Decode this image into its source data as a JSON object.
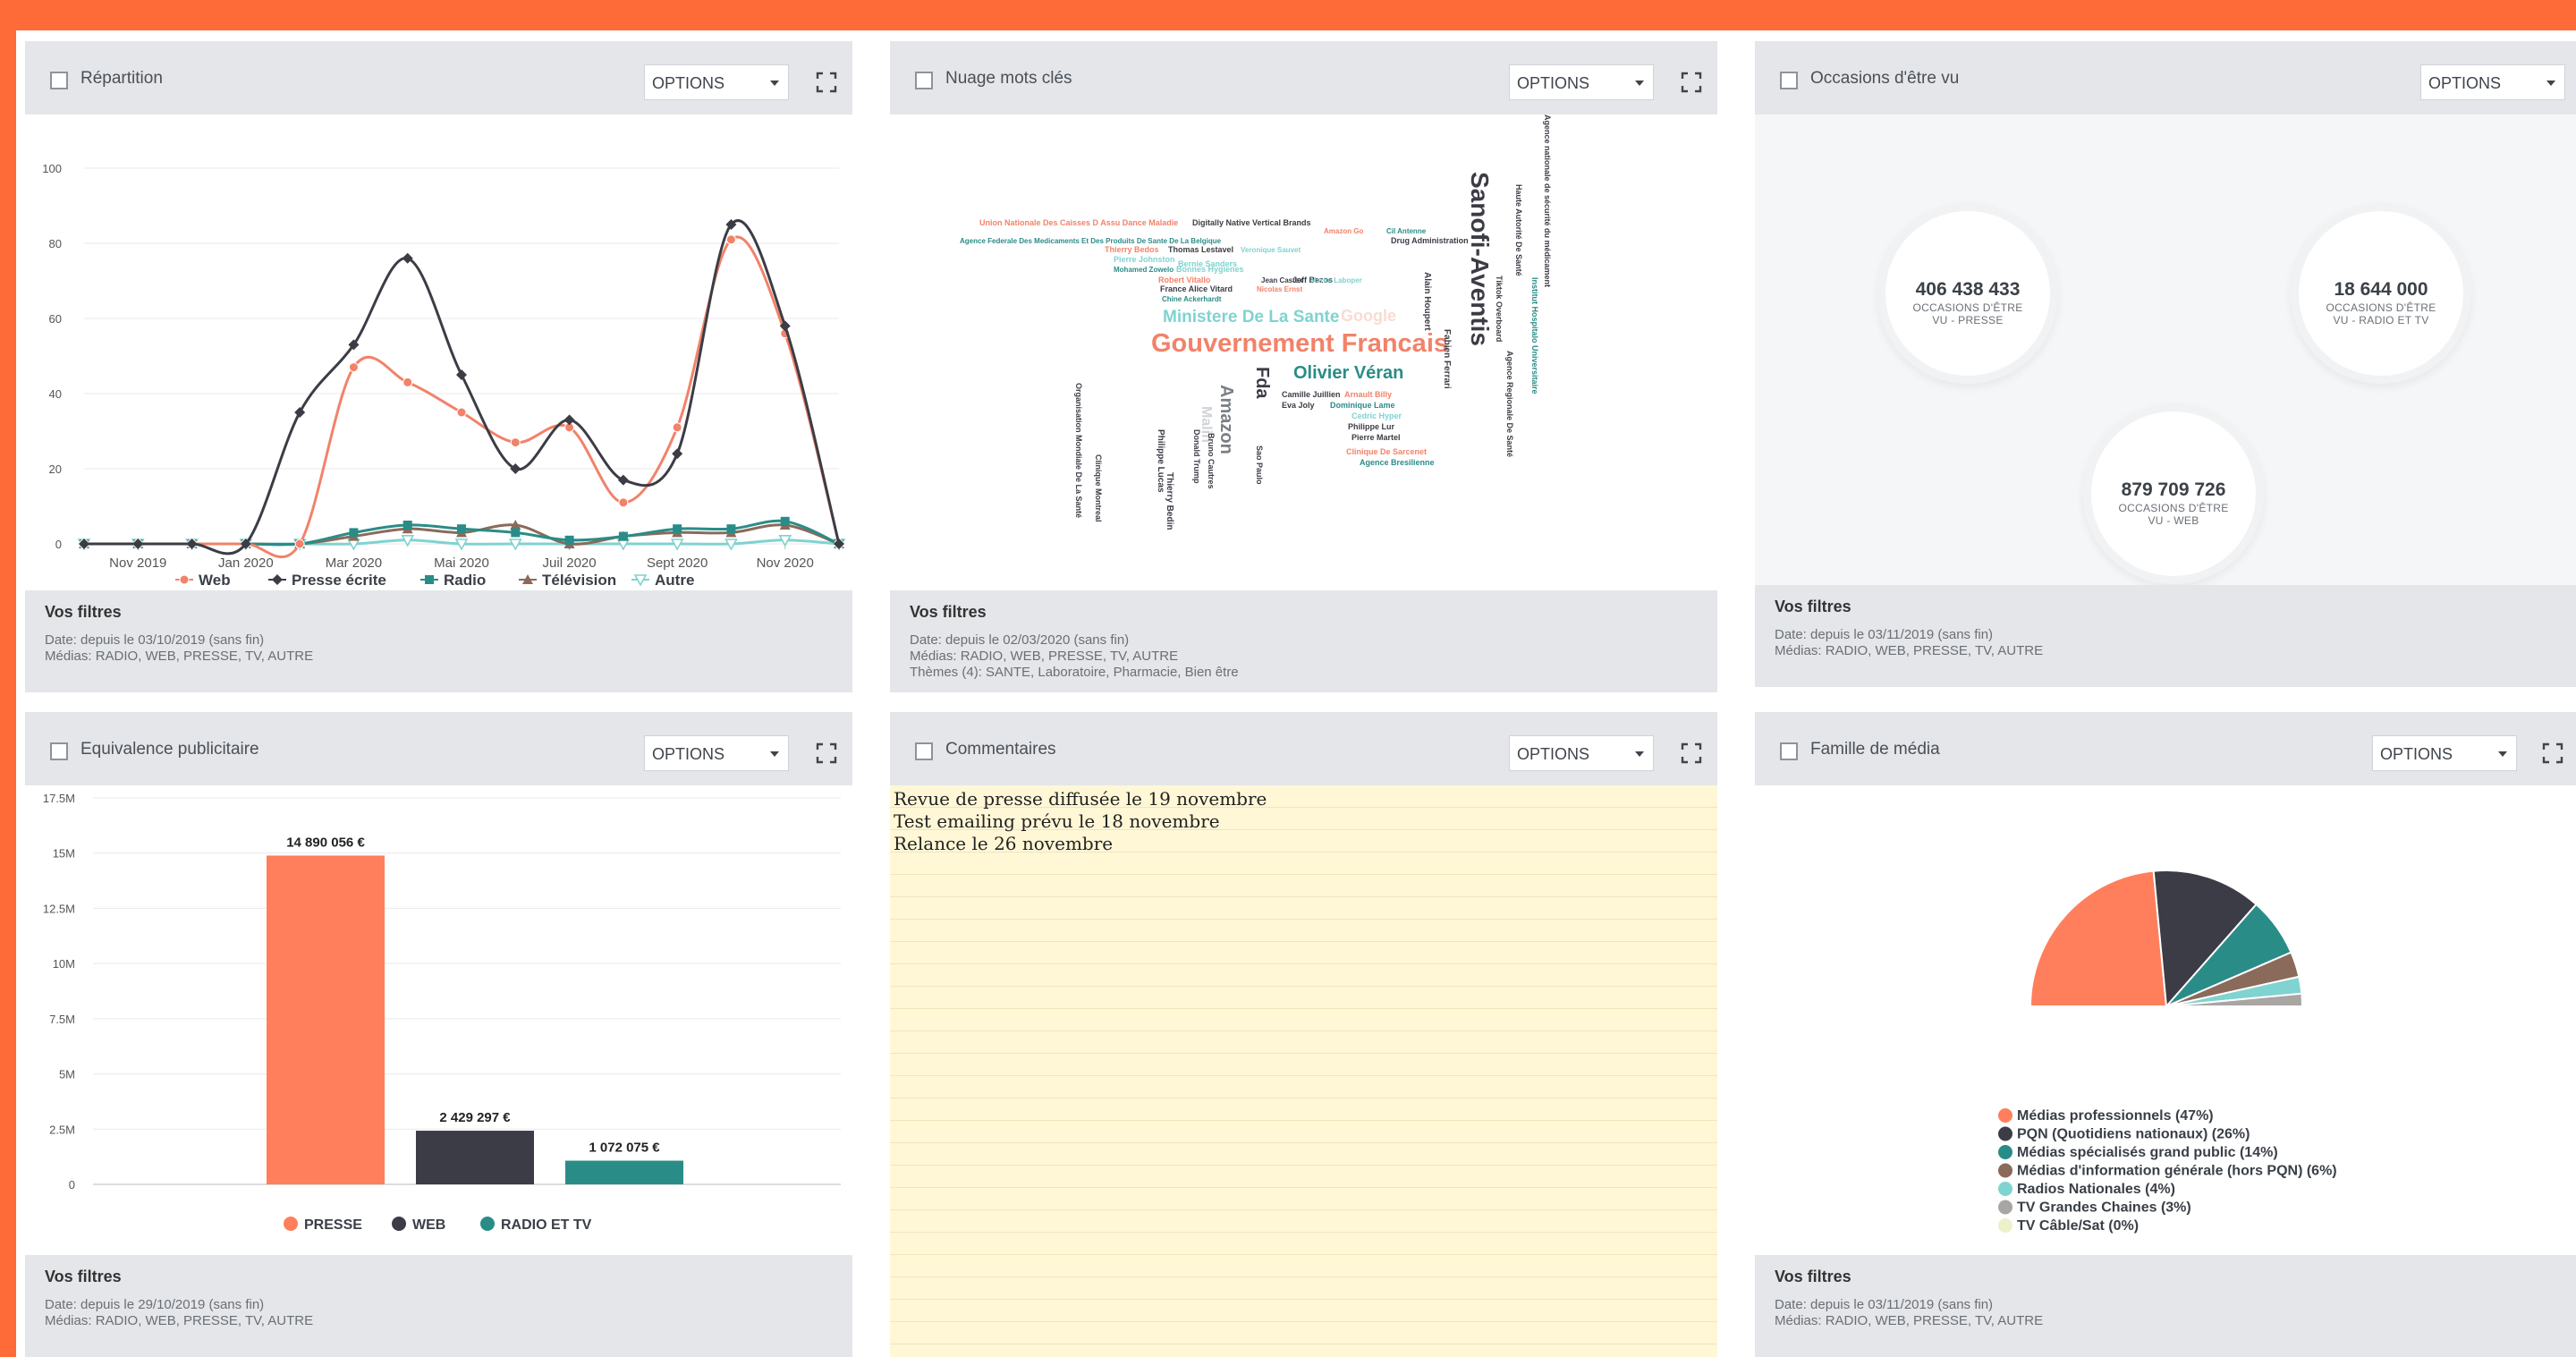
{
  "common": {
    "options_label": "OPTIONS",
    "filters_title": "Vos filtres"
  },
  "colors": {
    "accent": "#ff6a39",
    "web": "#f2826a",
    "presse": "#3c3c46",
    "radio": "#2a8c87",
    "television": "#8a6a5a",
    "autre": "#7fd3d0"
  },
  "panels": {
    "repartition": {
      "title": "Répartition",
      "filters": [
        "Date: depuis le 03/10/2019 (sans fin)",
        "Médias: RADIO, WEB, PRESSE, TV, AUTRE"
      ]
    },
    "nuage": {
      "title": "Nuage mots clés",
      "filters": [
        "Date: depuis le 02/03/2020 (sans fin)",
        "Médias: RADIO, WEB, PRESSE, TV, AUTRE",
        "Thèmes (4): SANTE, Laboratoire, Pharmacie, Bien être"
      ],
      "words_h": [
        {
          "t": "Union Nationale Des Caisses D Assu Dance Maladie",
          "c": "#f2826a"
        },
        {
          "t": "Digitally Native Vertical Brands",
          "c": "#3c3c46"
        },
        {
          "t": "Amazon Go",
          "c": "#f2826a"
        },
        {
          "t": "Cil Antenne",
          "c": "#2a8c87"
        },
        {
          "t": "Agence Federale Des Medicaments Et Des Produits De Sante De La Belgique",
          "c": "#2a8c87"
        },
        {
          "t": "Drug Administration",
          "c": "#3c3c46"
        },
        {
          "t": "Thierry Bedos",
          "c": "#f2826a"
        },
        {
          "t": "Thomas Lestavel",
          "c": "#3c3c46"
        },
        {
          "t": "Veronique Sauvet",
          "c": "#7fd3d0"
        },
        {
          "t": "Pierre Johnston",
          "c": "#7fd3d0"
        },
        {
          "t": "Bernie Sanders",
          "c": "#7fd3d0"
        },
        {
          "t": "Mohamed Zowelo",
          "c": "#2a8c87"
        },
        {
          "t": "Bonnes Hygienes",
          "c": "#7fd3d0"
        },
        {
          "t": "Robert Vitallo",
          "c": "#f2826a"
        },
        {
          "t": "Jean Castex",
          "c": "#3c3c46"
        },
        {
          "t": "Jeff Bezos",
          "c": "#3c3c46"
        },
        {
          "t": "Martin Laboper",
          "c": "#7fd3d0"
        },
        {
          "t": "France Alice Vitard",
          "c": "#3c3c46"
        },
        {
          "t": "Nicolas Ernst",
          "c": "#f2826a"
        },
        {
          "t": "Chine Ackerhardt",
          "c": "#2a8c87"
        },
        {
          "t": "Ministere De La Sante",
          "c": "#7fd3d0"
        },
        {
          "t": "Google",
          "c": "#f8dcd2"
        },
        {
          "t": "Gouvernement Francais",
          "c": "#f2826a"
        },
        {
          "t": "Olivier Véran",
          "c": "#2a8c87"
        },
        {
          "t": "Camille Juillien",
          "c": "#3c3c46"
        },
        {
          "t": "Arnault Billy",
          "c": "#f2826a"
        },
        {
          "t": "Eva Joly",
          "c": "#3c3c46"
        },
        {
          "t": "Dominique Lame",
          "c": "#2a8c87"
        },
        {
          "t": "Cedric Hyper",
          "c": "#7fd3d0"
        },
        {
          "t": "Philippe Lur",
          "c": "#3c3c46"
        },
        {
          "t": "Pierre Martel",
          "c": "#3c3c46"
        },
        {
          "t": "Clinique De Sarcenet",
          "c": "#f2826a"
        },
        {
          "t": "Agence Bresilienne",
          "c": "#2a8c87"
        }
      ],
      "words_v": [
        {
          "t": "Sanofi-Aventis",
          "c": "#3c3c46"
        },
        {
          "t": "Agence nationale de sécurité du médicament",
          "c": "#3c3c46"
        },
        {
          "t": "Haute Autorité De Santé",
          "c": "#3c3c46"
        },
        {
          "t": "Tiktok Overboard",
          "c": "#3c3c46"
        },
        {
          "t": "Institut Hospitalo Universitaire",
          "c": "#2a8c87"
        },
        {
          "t": "Agence Regionale De Santé",
          "c": "#3c3c46"
        },
        {
          "t": "Fabien Ferrari",
          "c": "#3c3c46"
        },
        {
          "t": "Alain Houpert",
          "c": "#3c3c46"
        },
        {
          "t": "Fda",
          "c": "#3c3c46"
        },
        {
          "t": "Amazon",
          "c": "#7a7f86"
        },
        {
          "t": "Malin",
          "c": "#cfd3d8"
        },
        {
          "t": "Donald Trump",
          "c": "#3c3c46"
        },
        {
          "t": "Bruno Cautres",
          "c": "#3c3c46"
        },
        {
          "t": "Philippe Lucas",
          "c": "#3c3c46"
        },
        {
          "t": "Thierry Bedin",
          "c": "#3c3c46"
        },
        {
          "t": "Sao Paulo",
          "c": "#3c3c46"
        },
        {
          "t": "Organisation Mondiale De La Santé",
          "c": "#3c3c46"
        },
        {
          "t": "Clinique Montreal",
          "c": "#3c3c46"
        }
      ]
    },
    "occasions": {
      "title": "Occasions d'être vu",
      "filters": [
        "Date: depuis le 03/11/2019 (sans fin)",
        "Médias: RADIO, WEB, PRESSE, TV, AUTRE"
      ],
      "bubbles": [
        {
          "value": "406 438 433",
          "line1": "OCCASIONS D'ÊTRE",
          "line2": "VU - PRESSE"
        },
        {
          "value": "18 644 000",
          "line1": "OCCASIONS D'ÊTRE",
          "line2": "VU - RADIO ET TV"
        },
        {
          "value": "879 709 726",
          "line1": "OCCASIONS D'ÊTRE",
          "line2": "VU - WEB"
        }
      ]
    },
    "equivalence": {
      "title": "Equivalence publicitaire",
      "filters": [
        "Date: depuis le 29/10/2019 (sans fin)",
        "Médias: RADIO, WEB, PRESSE, TV, AUTRE"
      ]
    },
    "commentaires": {
      "title": "Commentaires",
      "notes": [
        "Revue de presse diffusée le 19 novembre",
        "Test emailing prévu le 18 novembre",
        "Relance le 26 novembre"
      ]
    },
    "famille": {
      "title": "Famille de média",
      "filters": [
        "Date: depuis le 03/11/2019 (sans fin)",
        "Médias: RADIO, WEB, PRESSE, TV, AUTRE"
      ]
    }
  },
  "chart_data": [
    {
      "type": "line",
      "title": "",
      "x": [
        "2019-10",
        "2019-11",
        "2019-12",
        "2020-01",
        "2020-02",
        "2020-03",
        "2020-04",
        "2020-05",
        "2020-06",
        "2020-07",
        "2020-08",
        "2020-09",
        "2020-10",
        "2020-11",
        "2020-12"
      ],
      "x_tick_labels": [
        "Nov 2019",
        "Jan 2020",
        "Mar 2020",
        "Mai 2020",
        "Juil 2020",
        "Sept 2020",
        "Nov 2020"
      ],
      "x_tick_indices": [
        1,
        3,
        5,
        7,
        9,
        11,
        13
      ],
      "ylim": [
        0,
        100
      ],
      "y_ticks": [
        0,
        20,
        40,
        60,
        80,
        100
      ],
      "grid": true,
      "legend_position": "bottom",
      "series": [
        {
          "name": "Web",
          "color": "#f2826a",
          "marker": "circle",
          "values": [
            0,
            0,
            0,
            0,
            0,
            47,
            43,
            35,
            27,
            31,
            11,
            31,
            81,
            56,
            0
          ]
        },
        {
          "name": "Presse écrite",
          "color": "#3c3c46",
          "marker": "diamond",
          "values": [
            0,
            0,
            0,
            0,
            35,
            53,
            76,
            45,
            20,
            33,
            17,
            24,
            85,
            58,
            0
          ]
        },
        {
          "name": "Radio",
          "color": "#2a8c87",
          "marker": "square",
          "values": [
            0,
            0,
            0,
            0,
            0,
            3,
            5,
            4,
            3,
            1,
            2,
            4,
            4,
            6,
            0
          ]
        },
        {
          "name": "Télévision",
          "color": "#8a6a5a",
          "marker": "triangle",
          "values": [
            0,
            0,
            0,
            0,
            0,
            2,
            4,
            3,
            5,
            0,
            2,
            3,
            3,
            5,
            0
          ]
        },
        {
          "name": "Autre",
          "color": "#7fd3d0",
          "marker": "triangle-down",
          "values": [
            0,
            0,
            0,
            0,
            0,
            0,
            1,
            0,
            0,
            0,
            0,
            0,
            0,
            1,
            0
          ]
        }
      ]
    },
    {
      "type": "bar",
      "title": "",
      "categories": [
        "PRESSE",
        "WEB",
        "RADIO ET TV"
      ],
      "values": [
        14890056,
        2429297,
        1072075
      ],
      "value_labels": [
        "14 890 056 €",
        "2 429 297 €",
        "1 072 075 €"
      ],
      "colors": [
        "#ff7f5c",
        "#3c3c46",
        "#2a8c87"
      ],
      "ylim": [
        0,
        17500000
      ],
      "y_tick_labels": [
        "0",
        "2.5M",
        "5M",
        "7.5M",
        "10M",
        "12.5M",
        "15M",
        "17.5M"
      ],
      "grid": true,
      "legend_position": "bottom"
    },
    {
      "type": "pie",
      "title": "",
      "legend_position": "bottom",
      "slices": [
        {
          "label": "Médias professionnels (47%)",
          "value": 47,
          "color": "#ff7f5c"
        },
        {
          "label": "PQN (Quotidiens nationaux) (26%)",
          "value": 26,
          "color": "#3c3c46"
        },
        {
          "label": "Médias spécialisés grand public (14%)",
          "value": 14,
          "color": "#2a8c87"
        },
        {
          "label": "Médias d'information générale (hors PQN) (6%)",
          "value": 6,
          "color": "#8a6a5a"
        },
        {
          "label": "Radios Nationales (4%)",
          "value": 4,
          "color": "#7fd3d0"
        },
        {
          "label": "TV Grandes Chaines (3%)",
          "value": 3,
          "color": "#a8a5a3"
        },
        {
          "label": "TV Câble/Sat (0%)",
          "value": 0,
          "color": "#eef0c8"
        }
      ]
    }
  ]
}
